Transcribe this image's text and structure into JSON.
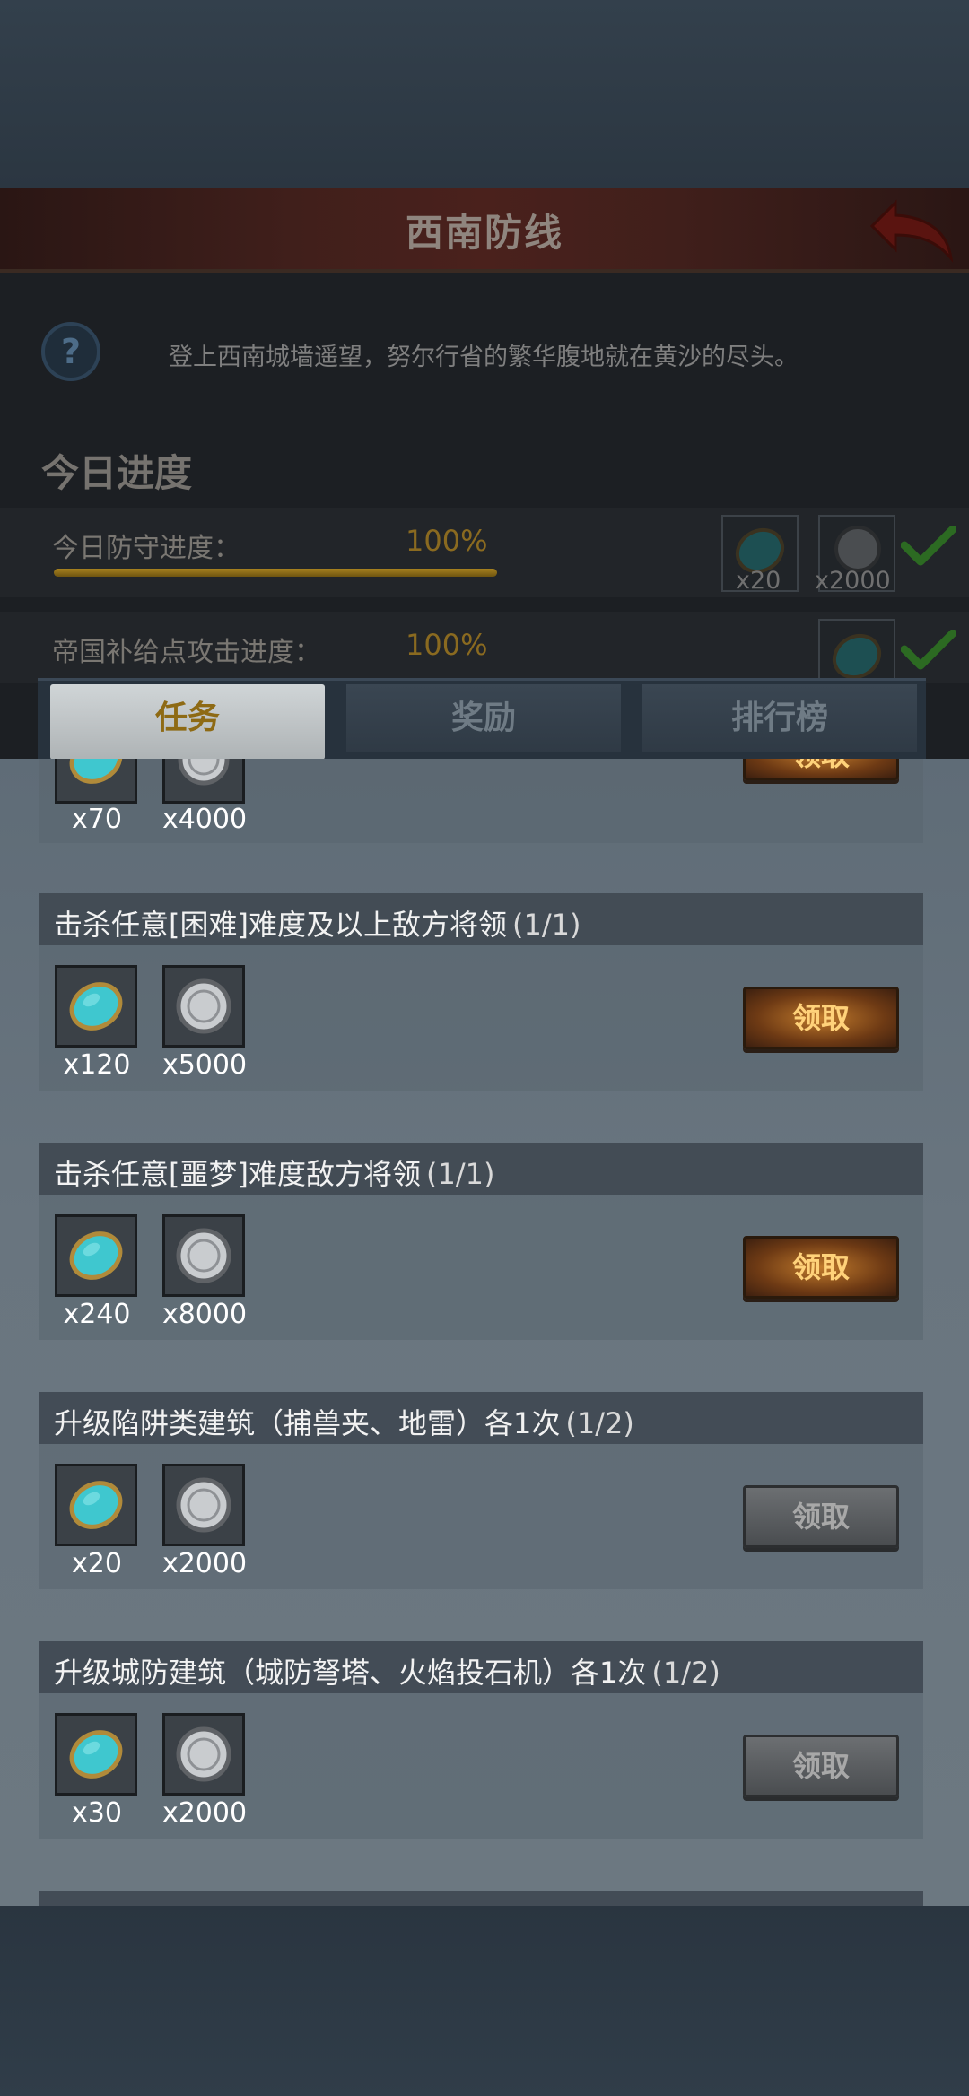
{
  "header": {
    "title": "西南防线",
    "description": "登上西南城墙遥望，努尔行省的繁华腹地就在黄沙的尽头。"
  },
  "today": {
    "section_title": "今日进度",
    "rows": [
      {
        "label": "今日防守进度：",
        "percent": "100%",
        "progress": 1.0,
        "rewards": [
          "x20",
          "x2000"
        ]
      },
      {
        "label": "帝国补给点攻击进度：",
        "percent": "100%",
        "progress": 1.0
      }
    ]
  },
  "tabs": [
    {
      "label": "任务",
      "active": true
    },
    {
      "label": "奖励",
      "active": false
    },
    {
      "label": "排行榜",
      "active": false
    }
  ],
  "tasks": [
    {
      "title": "",
      "progress": "",
      "gem_qty": "x70",
      "coin_qty": "x4000",
      "claim_label": "领取",
      "claimable": true
    },
    {
      "title": "击杀任意[困难]难度及以上敌方将领",
      "progress": "(1/1)",
      "gem_qty": "x120",
      "coin_qty": "x5000",
      "claim_label": "领取",
      "claimable": true
    },
    {
      "title": "击杀任意[噩梦]难度敌方将领",
      "progress": "(1/1)",
      "gem_qty": "x240",
      "coin_qty": "x8000",
      "claim_label": "领取",
      "claimable": true
    },
    {
      "title": "升级陷阱类建筑（捕兽夹、地雷）各1次",
      "progress": "(1/2)",
      "gem_qty": "x20",
      "coin_qty": "x2000",
      "claim_label": "领取",
      "claimable": false
    },
    {
      "title": "升级城防建筑（城防弩塔、火焰投石机）各1次",
      "progress": "(1/2)",
      "gem_qty": "x30",
      "coin_qty": "x2000",
      "claim_label": "领取",
      "claimable": false
    }
  ],
  "colors": {
    "gem": "#3fc7cf",
    "coin": "#c9cccf",
    "claim_active": "#c07a2c",
    "claim_disabled": "#6c6f72"
  }
}
